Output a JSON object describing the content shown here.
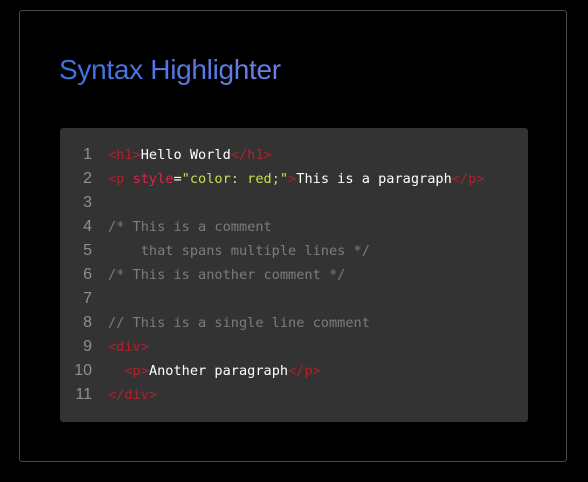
{
  "page": {
    "title": "Syntax Highlighter"
  },
  "colors": {
    "tag": "#b3202a",
    "attribute": "#e0224c",
    "string": "#c5e14f",
    "comment": "#7c7c7c",
    "text": "#ffffff",
    "line_number": "#8f8f8f",
    "code_background": "#333333",
    "title_gradient_start": "#3f6fe2",
    "title_gradient_end": "#6a7fe8"
  },
  "code": {
    "lines": [
      {
        "number": "1",
        "tokens": [
          {
            "type": "tag",
            "text": "<h1>"
          },
          {
            "type": "text",
            "text": "Hello World"
          },
          {
            "type": "tag",
            "text": "</h1>"
          }
        ]
      },
      {
        "number": "2",
        "tokens": [
          {
            "type": "tag",
            "text": "<p "
          },
          {
            "type": "attr",
            "text": "style"
          },
          {
            "type": "text",
            "text": "="
          },
          {
            "type": "str",
            "text": "\"color: red;\""
          },
          {
            "type": "tag",
            "text": ">"
          },
          {
            "type": "text",
            "text": "This is a paragraph"
          },
          {
            "type": "tag",
            "text": "</p>"
          }
        ]
      },
      {
        "number": "3",
        "tokens": []
      },
      {
        "number": "4",
        "tokens": [
          {
            "type": "cmt",
            "text": "/* This is a comment"
          }
        ]
      },
      {
        "number": "5",
        "tokens": [
          {
            "type": "cmt",
            "text": "    that spans multiple lines */"
          }
        ]
      },
      {
        "number": "6",
        "tokens": [
          {
            "type": "cmt",
            "text": "/* This is another comment */"
          }
        ]
      },
      {
        "number": "7",
        "tokens": []
      },
      {
        "number": "8",
        "tokens": [
          {
            "type": "cmt",
            "text": "// This is a single line comment"
          }
        ]
      },
      {
        "number": "9",
        "tokens": [
          {
            "type": "tag",
            "text": "<div>"
          }
        ]
      },
      {
        "number": "10",
        "tokens": [
          {
            "type": "text",
            "text": "  "
          },
          {
            "type": "tag",
            "text": "<p>"
          },
          {
            "type": "text",
            "text": "Another paragraph"
          },
          {
            "type": "tag",
            "text": "</p>"
          }
        ]
      },
      {
        "number": "11",
        "tokens": [
          {
            "type": "tag",
            "text": "</div>"
          }
        ]
      }
    ]
  }
}
